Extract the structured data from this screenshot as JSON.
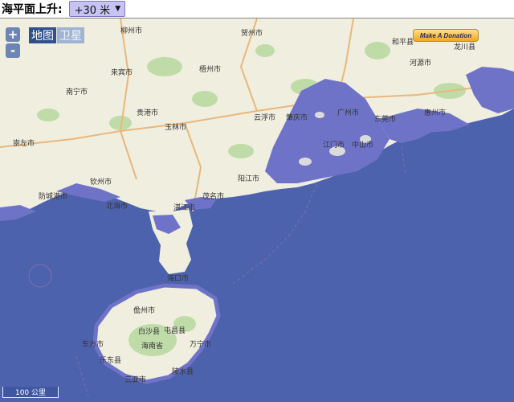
{
  "controls": {
    "sea_level_label": "海平面上升:",
    "sea_level_value": "+30 米"
  },
  "map": {
    "zoom_in": "+",
    "zoom_out": "-",
    "type_map": "地图",
    "type_satellite": "卫星",
    "donation": "Make A Donation",
    "scale": "100 公里",
    "colors": {
      "sea": "#4d62ac",
      "land": "#f0eedf",
      "flood": "#6f73c8",
      "forest": "#bfdca8",
      "road": "#e9b77c"
    },
    "places": [
      {
        "name": "柳州市"
      },
      {
        "name": "贺州市"
      },
      {
        "name": "和平县"
      },
      {
        "name": "龙川县"
      },
      {
        "name": "来宾市"
      },
      {
        "name": "梧州市"
      },
      {
        "name": "河源市"
      },
      {
        "name": "南宁市"
      },
      {
        "name": "贵港市"
      },
      {
        "name": "玉林市"
      },
      {
        "name": "云浮市"
      },
      {
        "name": "肇庆市"
      },
      {
        "name": "广州市"
      },
      {
        "name": "东莞市"
      },
      {
        "name": "惠州市"
      },
      {
        "name": "江门市"
      },
      {
        "name": "中山市"
      },
      {
        "name": "崇左市"
      },
      {
        "name": "北海市"
      },
      {
        "name": "湛江市"
      },
      {
        "name": "茂名市"
      },
      {
        "name": "阳江市"
      },
      {
        "name": "海口市"
      },
      {
        "name": "儋州市"
      },
      {
        "name": "海南省"
      },
      {
        "name": "三亚市"
      },
      {
        "name": "钦州市"
      },
      {
        "name": "防城港市"
      },
      {
        "name": "东方市"
      },
      {
        "name": "屯昌县"
      },
      {
        "name": "白沙县"
      },
      {
        "name": "乐东县"
      },
      {
        "name": "陵水县"
      },
      {
        "name": "万宁市"
      }
    ]
  }
}
